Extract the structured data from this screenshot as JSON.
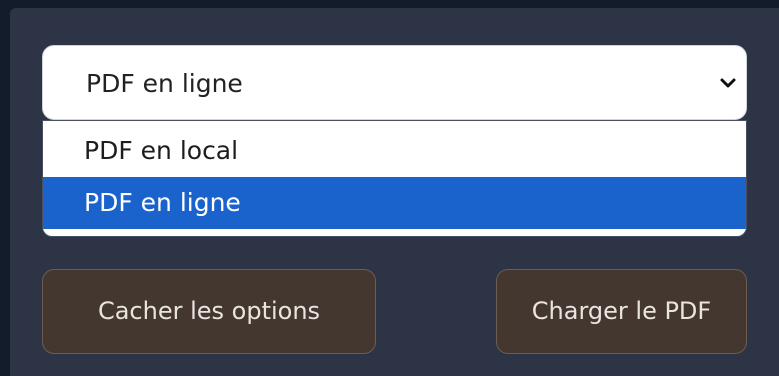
{
  "source_select": {
    "selected_value": "PDF en ligne",
    "icon": "chevron-down-icon"
  },
  "dropdown": {
    "options": [
      {
        "label": "PDF en local",
        "highlighted": false
      },
      {
        "label": "PDF en ligne",
        "highlighted": true
      }
    ]
  },
  "buttons": {
    "hide_options_label": "Cacher les options",
    "load_pdf_label": "Charger le PDF"
  },
  "colors": {
    "background_outer": "#121c2b",
    "panel": "#2c3446",
    "highlight": "#1a62cc",
    "button_bg": "#44372f",
    "button_text": "#e9e4df"
  }
}
